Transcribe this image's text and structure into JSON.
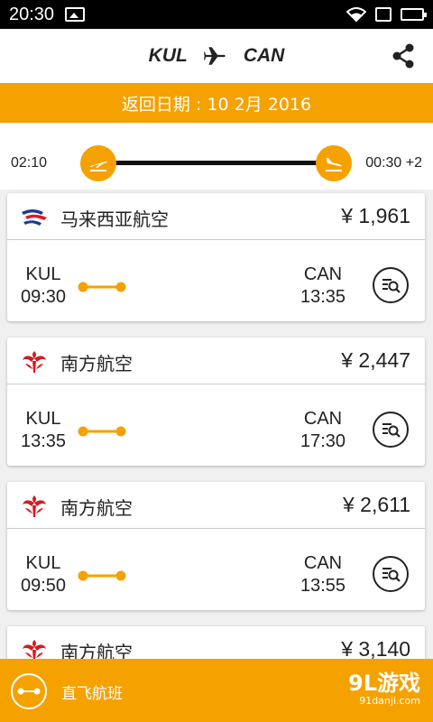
{
  "status_bar": {
    "time": "20:30"
  },
  "header": {
    "origin": "KUL",
    "destination": "CAN"
  },
  "date_bar": {
    "label": "返回日期 : 10 2月 2016"
  },
  "time_filter": {
    "start": "02:10",
    "end": "00:30 +2"
  },
  "flights": [
    {
      "airline": "马来西亚航空",
      "logo": "malaysia-airlines-logo",
      "price": "¥ 1,961",
      "from_code": "KUL",
      "from_time": "09:30",
      "to_code": "CAN",
      "to_time": "13:35"
    },
    {
      "airline": "南方航空",
      "logo": "china-southern-logo",
      "price": "¥ 2,447",
      "from_code": "KUL",
      "from_time": "13:35",
      "to_code": "CAN",
      "to_time": "17:30"
    },
    {
      "airline": "南方航空",
      "logo": "china-southern-logo",
      "price": "¥ 2,611",
      "from_code": "KUL",
      "from_time": "09:50",
      "to_code": "CAN",
      "to_time": "13:55"
    },
    {
      "airline": "南方航空",
      "logo": "china-southern-logo",
      "price": "¥ 3,140"
    }
  ],
  "bottom_bar": {
    "label": "直飞航班"
  },
  "watermark": {
    "brand": "9L游戏",
    "site": "91danji.com"
  },
  "colors": {
    "accent": "#f5a100",
    "malaysia_red": "#d81e2c",
    "malaysia_blue": "#1d3c8f",
    "southern_red": "#d71920"
  }
}
